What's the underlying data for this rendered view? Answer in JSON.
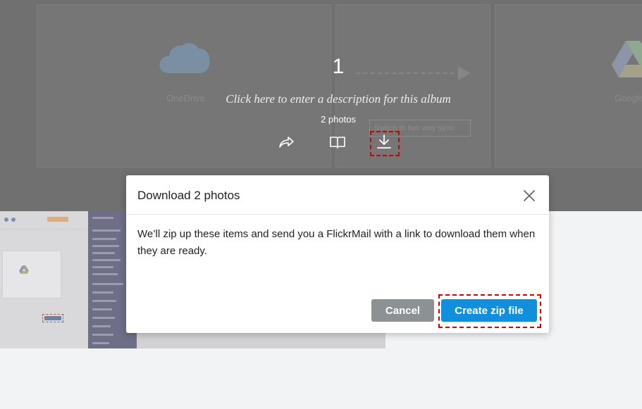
{
  "album": {
    "title": "1",
    "description_placeholder": "Click here to enter a description for this album",
    "photo_count": "2 photos",
    "actions": {
      "share_icon": "share-icon",
      "book_icon": "book-icon",
      "download_icon": "download-icon"
    }
  },
  "background": {
    "onedrive_label": "OneDrive",
    "google_label": "Google",
    "sync_button": "Switch to two way sync"
  },
  "dialog": {
    "title": "Download 2 photos",
    "close_icon": "close-icon",
    "message": "We’ll zip up these items and send you a FlickrMail with a link to download them when they are ready.",
    "cancel_label": "Cancel",
    "create_label": "Create zip file"
  },
  "colors": {
    "primary_button": "#128fdc",
    "cancel_button": "#8c9293",
    "highlight": "#d40000"
  }
}
